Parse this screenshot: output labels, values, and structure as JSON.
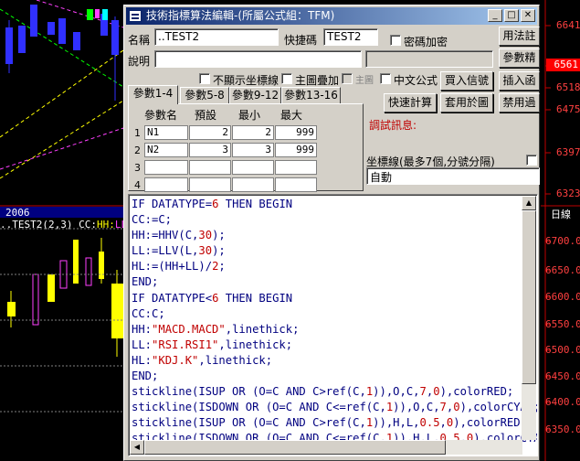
{
  "window": {
    "title": "技術指標算法編輯-(所屬公式組：TFM)"
  },
  "form": {
    "name_label": "名稱",
    "name_value": "..TEST2",
    "shortcut_label": "快捷碼",
    "shortcut_value": "TEST2",
    "password_label": "密碼加密",
    "desc_label": "說明",
    "desc_value": "",
    "no_axis_label": "不顯示坐標線",
    "main_overlay_label": "主圖疊加",
    "main_label": "主圖",
    "chinese_formula_label": "中文公式"
  },
  "buttons": {
    "usage": "用法註",
    "param_precision": "參數精",
    "buy_signal": "買入信號",
    "insert_func": "插入函",
    "quick_calc": "快速計算",
    "apply_chart": "套用於圖",
    "disable": "禁用過"
  },
  "tabs": [
    "參數1-4",
    "參數5-8",
    "參數9-12",
    "參數13-16"
  ],
  "params": {
    "headers": [
      "參數名",
      "預設",
      "最小",
      "最大"
    ],
    "rows": [
      {
        "idx": "1",
        "name": "N1",
        "default": "2",
        "min": "2",
        "max": "999"
      },
      {
        "idx": "2",
        "name": "N2",
        "default": "3",
        "min": "3",
        "max": "999"
      },
      {
        "idx": "3",
        "name": "",
        "default": "",
        "min": "",
        "max": ""
      },
      {
        "idx": "4",
        "name": "",
        "default": "",
        "min": "",
        "max": ""
      }
    ]
  },
  "debug": {
    "label": "調試訊息:"
  },
  "axis": {
    "label": "坐標線(最多7個,分號分隔)",
    "value": "自動"
  },
  "code_lines": [
    [
      "IF DATATYPE=",
      [
        "6"
      ],
      " THEN BEGIN"
    ],
    [
      "CC:=C;"
    ],
    [
      "HH:=HHV(C,",
      [
        "30"
      ],
      ");"
    ],
    [
      "LL:=LLV(L,",
      [
        "30"
      ],
      ");"
    ],
    [
      "HL:=(HH+LL)/",
      [
        "2"
      ],
      ";"
    ],
    [
      "END;"
    ],
    [
      "IF DATATYPE<",
      [
        "6"
      ],
      " THEN BEGIN"
    ],
    [
      "CC:C;"
    ],
    [
      "HH:",
      [
        "\"MACD.MACD\""
      ],
      ",linethick;"
    ],
    [
      "LL:",
      [
        "\"RSI.RSI1\""
      ],
      ",linethick;"
    ],
    [
      "HL:",
      [
        "\"KDJ.K\""
      ],
      ",linethick;"
    ],
    [
      "END;"
    ],
    [
      "stickline(ISUP OR (O=C AND C>ref(C,",
      [
        "1"
      ],
      ")),O,C,",
      [
        "7"
      ],
      ",",
      [
        "0"
      ],
      "),colorRED;"
    ],
    [
      "stickline(ISDOWN OR (O=C AND C<=ref(C,",
      [
        "1"
      ],
      ")),O,C,",
      [
        "7"
      ],
      ",",
      [
        "0"
      ],
      "),colorCYAN;"
    ],
    [
      "stickline(ISUP OR (O=C AND C>ref(C,",
      [
        "1"
      ],
      ")),H,L,",
      [
        "0.5"
      ],
      ",",
      [
        "0"
      ],
      "),colorRED;"
    ],
    [
      "stickline(ISDOWN OR (O=C AND C<=ref(C,",
      [
        "1"
      ],
      ")),H,L,",
      [
        "0.5"
      ],
      ",",
      [
        "0"
      ],
      "),colorCYAN;"
    ]
  ],
  "chart": {
    "year_label": "2006",
    "indicator_label": "..TEST2(2,3) CC:",
    "indicator_hh": "HH:",
    "indicator_ll": "LL:",
    "right_axis_top": [
      "6641",
      "6561",
      "6518",
      "6475",
      "6397",
      "6323"
    ],
    "right_axis_top_highlight": "6561",
    "right_axis_bottom_label": "日線",
    "right_axis_bottom": [
      "6700.00",
      "6650.00",
      "6600.00",
      "6550.00",
      "6500.00",
      "6450.00",
      "6400.00",
      "6350.00"
    ],
    "colors": {
      "up": "#ff4040",
      "down": "#00ffff",
      "highlight": "#ff0000"
    }
  }
}
